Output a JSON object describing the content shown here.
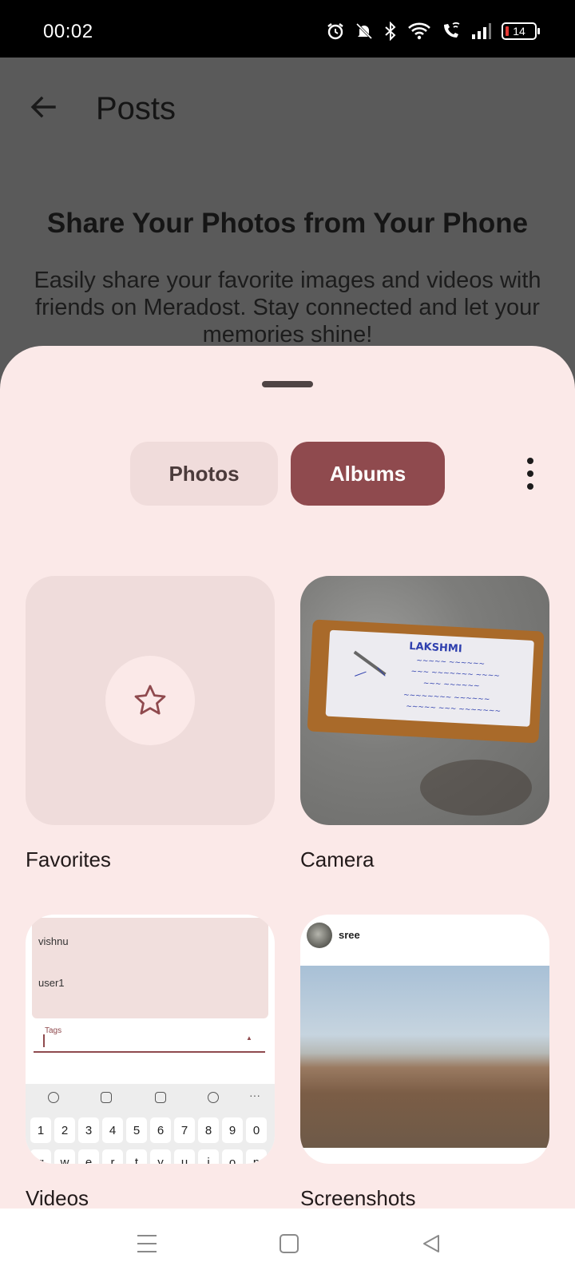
{
  "status_bar": {
    "time": "00:02",
    "battery": "14",
    "icons": [
      "alarm-icon",
      "mute-icon",
      "bluetooth-icon",
      "wifi-icon",
      "wifi-call-icon",
      "signal-icon",
      "battery-icon"
    ]
  },
  "app_bar": {
    "title": "Posts",
    "back_icon": "back-arrow-icon"
  },
  "hero": {
    "title": "Share Your Photos from Your Phone",
    "text": "Easily share your favorite images and videos with friends on Meradost. Stay connected and let your memories shine!"
  },
  "sheet": {
    "tabs": [
      {
        "label": "Photos",
        "selected": false
      },
      {
        "label": "Albums",
        "selected": true
      }
    ],
    "more_icon": "more-vert-icon",
    "albums": [
      {
        "label": "Favorites",
        "icon": "star-icon"
      },
      {
        "label": "Camera"
      },
      {
        "label": "Videos"
      },
      {
        "label": "Screenshots"
      }
    ]
  },
  "videos_preview": {
    "names": [
      "vishnu",
      "user1"
    ],
    "tags_label": "Tags",
    "keys": [
      "1",
      "2",
      "3",
      "4",
      "5",
      "6",
      "7",
      "8",
      "9",
      "0"
    ],
    "keys_row2": [
      "q",
      "w",
      "e",
      "r",
      "t",
      "y",
      "u",
      "i",
      "o",
      "p"
    ]
  },
  "screenshots_preview": {
    "username": "sree"
  },
  "nav_bar": {
    "icons": [
      "recents-icon",
      "home-icon",
      "back-icon"
    ]
  },
  "colors": {
    "sheet_bg": "#fbe9e8",
    "accent": "#8f4a4e",
    "scrim": "#5a5a5a"
  }
}
